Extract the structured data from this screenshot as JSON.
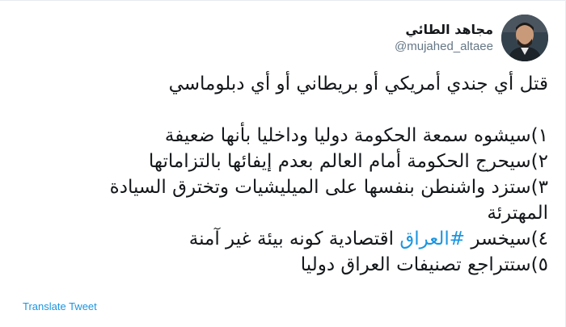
{
  "tweet": {
    "display_name": "مجاهد الطائي",
    "handle": "@mujahed_altaee",
    "lines": [
      "قتل أي جندي أمريكي أو بريطاني أو أي دبلوماسي",
      "",
      "١)سيشوه سمعة الحكومة دوليا وداخليا بأنها ضعيفة",
      "٢)سيحرج الحكومة أمام العالم بعدم إيفائها بالتزاماتها",
      "٣)ستزد واشنطن بنفسها على الميليشيات وتخترق السيادة",
      "المهترئة"
    ],
    "line4_prefix": "٤)سيخسر ",
    "hashtag": "#العراق",
    "line4_suffix": " اقتصادية كونه بيئة غير آمنة",
    "line5": "٥)ستتراجع تصنيفات العراق دوليا",
    "translate_label": "Translate Tweet"
  },
  "colors": {
    "link": "#1b95e0",
    "text": "#14171a",
    "muted": "#657786"
  }
}
